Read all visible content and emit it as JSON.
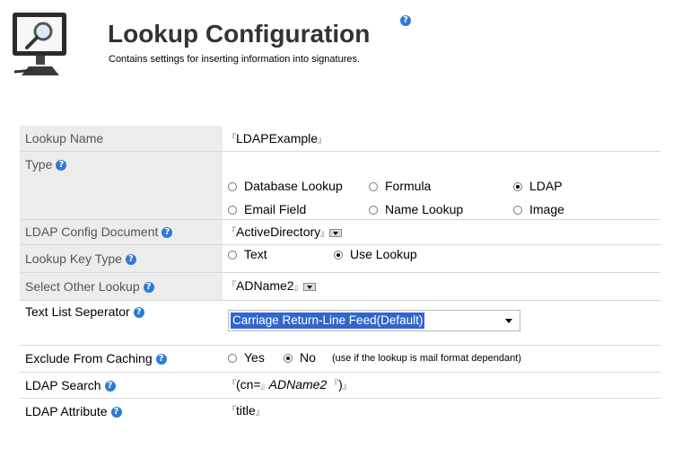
{
  "header": {
    "title": "Lookup Configuration",
    "subtitle": "Contains settings for inserting information into signatures.",
    "icon": "computer-magnifier-icon",
    "help_icon": "help-icon"
  },
  "form": {
    "lookup_name": {
      "label": "Lookup Name",
      "value": "LDAPExample"
    },
    "type": {
      "label": "Type",
      "options": [
        "Database Lookup",
        "Formula",
        "LDAP",
        "Email Field",
        "Name Lookup",
        "Image"
      ],
      "selected": "LDAP"
    },
    "ldap_config": {
      "label": "LDAP Config Document",
      "value": "ActiveDirectory"
    },
    "lookup_key_type": {
      "label": "Lookup Key Type",
      "options": [
        "Text",
        "Use Lookup"
      ],
      "selected": "Use Lookup"
    },
    "select_other_lookup": {
      "label": "Select Other Lookup",
      "value": "ADName2"
    },
    "text_list_separator": {
      "label": "Text List Seperator",
      "value": "Carriage Return-Line Feed(Default)"
    },
    "exclude_from_caching": {
      "label": "Exclude From Caching",
      "options": [
        "Yes",
        "No"
      ],
      "selected": "No",
      "note": "(use if the lookup is mail format dependant)"
    },
    "ldap_search": {
      "label": "LDAP Search",
      "prefix": "(cn=",
      "field": "ADName2",
      "suffix": ")"
    },
    "ldap_attribute": {
      "label": "LDAP Attribute",
      "value": "title"
    }
  },
  "marks": {
    "open": "『",
    "close": "』"
  },
  "colors": {
    "label_bg": "#ececec",
    "selection": "#3366cc",
    "help": "#2f7ad8"
  }
}
